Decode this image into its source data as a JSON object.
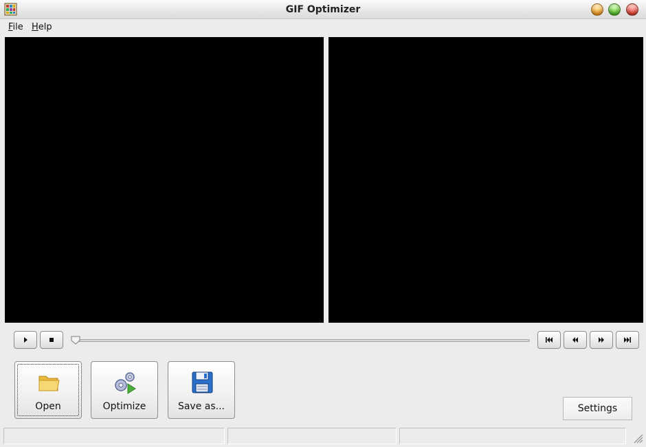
{
  "window": {
    "title": "GIF Optimizer",
    "icon": "gif-app-icon",
    "controls": [
      "minimize-icon",
      "maximize-icon",
      "close-icon"
    ]
  },
  "menu": {
    "items": [
      {
        "label_rest": "ile",
        "mnemonic": "F"
      },
      {
        "label_rest": "elp",
        "mnemonic": "H"
      }
    ]
  },
  "player": {
    "controls_left": [
      {
        "name": "play-icon",
        "glyph": "▶"
      },
      {
        "name": "stop-icon",
        "glyph": "■"
      }
    ],
    "controls_right": [
      {
        "name": "first-frame-icon",
        "glyph": "⏮"
      },
      {
        "name": "previous-frame-icon",
        "glyph": "⏪"
      },
      {
        "name": "next-frame-icon",
        "glyph": "⏩"
      },
      {
        "name": "last-frame-icon",
        "glyph": "⏭"
      }
    ],
    "position": 0
  },
  "actions": {
    "open": {
      "label": "Open",
      "icon": "folder-icon"
    },
    "optimize": {
      "label": "Optimize",
      "icon": "gears-icon"
    },
    "save_as": {
      "label": "Save as...",
      "icon": "floppy-disk-icon"
    },
    "settings": {
      "label": "Settings"
    }
  },
  "status": {
    "cells": [
      "",
      "",
      ""
    ]
  },
  "colors": {
    "preview_bg": "#000000",
    "window_bg": "#ececec"
  }
}
